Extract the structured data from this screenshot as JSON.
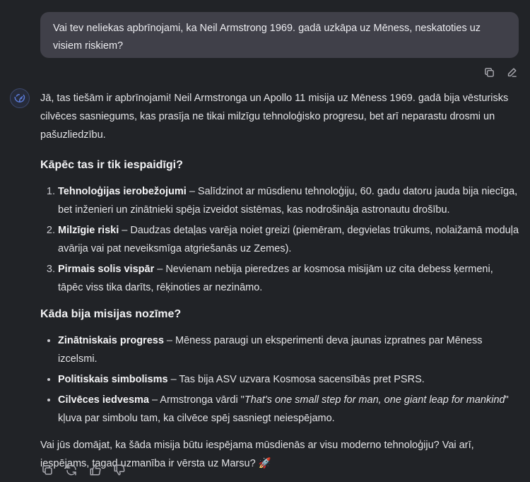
{
  "user_message": {
    "text": "Vai tev neliekas apbrīnojami, ka Neil Armstrong 1969. gadā uzkāpa uz Mēness, neskatoties uz visiem riskiem?",
    "actions": [
      "copy-icon",
      "edit-icon"
    ]
  },
  "assistant": {
    "avatar_icon": "whale-logo-icon",
    "intro": "Jā, tas tiešām ir apbrīnojami! Neil Armstronga un Apollo 11 misija uz Mēness 1969. gadā bija vēsturisks cilvēces sasniegums, kas prasīja ne tikai milzīgu tehnoloģisko progresu, bet arī neparastu drosmi un pašuzliedzību.",
    "section1_title": "Kāpēc tas ir tik iespaidīgi?",
    "reasons": [
      {
        "title": "Tehnoloģijas ierobežojumi",
        "text": " – Salīdzinot ar mūsdienu tehnoloģiju, 60. gadu datoru jauda bija niecīga, bet inženieri un zinātnieki spēja izveidot sistēmas, kas nodrošināja astronautu drošību."
      },
      {
        "title": "Milzīgie riski",
        "text": " – Daudzas detaļas varēja noiet greizi (piemēram, degvielas trūkums, nolaižamā moduļa avārija vai pat neveiksmīga atgriešanās uz Zemes)."
      },
      {
        "title": "Pirmais solis vispār",
        "text": " – Nevienam nebija pieredzes ar kosmosa misijām uz cita debess ķermeni, tāpēc viss tika darīts, rēķinoties ar nezināmo."
      }
    ],
    "section2_title": "Kāda bija misijas nozīme?",
    "points": [
      {
        "title": "Zinātniskais progress",
        "text": " – Mēness paraugi un eksperimenti deva jaunas izpratnes par Mēness izcelsmi."
      },
      {
        "title": "Politiskais simbolisms",
        "text": " – Tas bija ASV uzvara Kosmosa sacensībās pret PSRS."
      },
      {
        "title": "Cilvēces iedvesma",
        "text_before": " – Armstronga vārdi \"",
        "quote": "That's one small step for man, one giant leap for mankind",
        "text_after": "\" kļuva par simbolu tam, ka cilvēce spēj sasniegt neiespējamo."
      }
    ],
    "closing": "Vai jūs domājat, ka šāda misija būtu iespējama mūsdienās ar visu moderno tehnoloģiju? Vai arī, iespējams, tagad uzmanība ir vērsta uz Marsu? 🚀",
    "actions": [
      "copy-icon",
      "regenerate-icon",
      "thumbs-up-icon",
      "thumbs-down-icon"
    ]
  },
  "colors": {
    "background": "#212327",
    "user_bubble": "#404049",
    "text": "#e3e3e6",
    "icon": "#a9a9b0",
    "avatar_accent": "#5b7bd8"
  }
}
